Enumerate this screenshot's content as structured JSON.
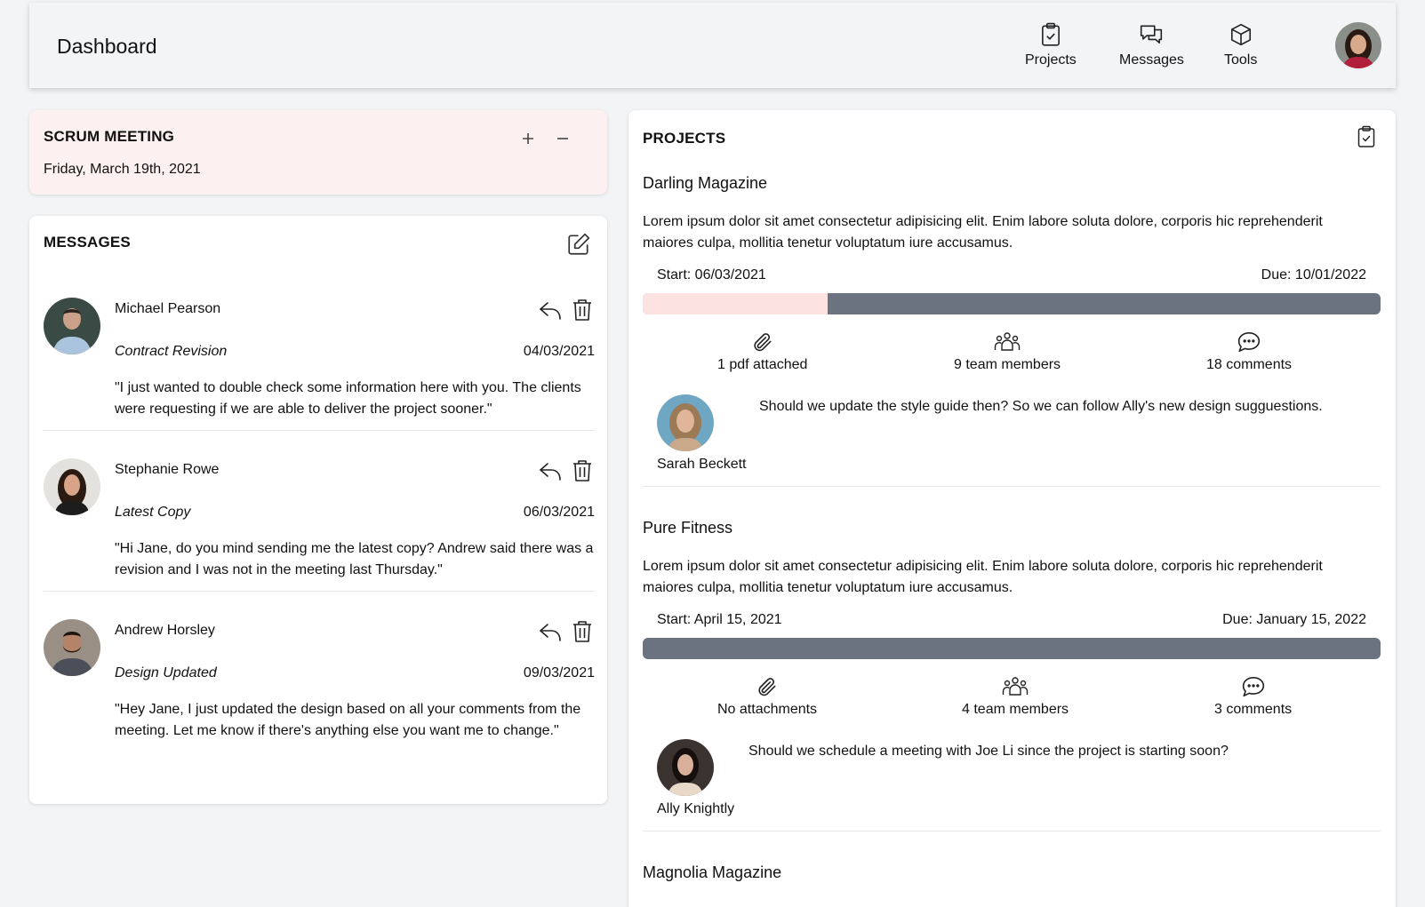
{
  "header": {
    "title": "Dashboard",
    "nav": [
      {
        "label": "Projects",
        "icon": "clipboard-check-icon"
      },
      {
        "label": "Messages",
        "icon": "chat-bubbles-icon"
      },
      {
        "label": "Tools",
        "icon": "cube-icon"
      }
    ]
  },
  "scrum": {
    "title": "SCRUM MEETING",
    "date": "Friday, March 19th, 2021",
    "accent": "#fdf0f0"
  },
  "messages": {
    "title": "MESSAGES",
    "items": [
      {
        "sender": "Michael Pearson",
        "subject": "Contract Revision",
        "date": "04/03/2021",
        "body": "\"I just wanted to double check some information here with you. The clients were requesting if we are able to deliver the project sooner.\""
      },
      {
        "sender": "Stephanie Rowe",
        "subject": "Latest Copy",
        "date": "06/03/2021",
        "body": "\"Hi Jane, do you mind sending me the latest copy? Andrew said there was a revision and I was not in the meeting last Thursday.\""
      },
      {
        "sender": "Andrew Horsley",
        "subject": "Design Updated",
        "date": "09/03/2021",
        "body": "\"Hey Jane, I just updated the design based on all your comments from the meeting. Let me know if there's anything else you want me to change.\""
      }
    ]
  },
  "projects": {
    "title": "PROJECTS",
    "items": [
      {
        "name": "Darling Magazine",
        "description": "Lorem ipsum dolor sit amet consectetur adipisicing elit. Enim labore soluta dolore, corporis hic reprehenderit maiores culpa, mollitia tenetur voluptatum iure accusamus.",
        "start": "Start: 06/03/2021",
        "due": "Due: 10/01/2022",
        "progress": 0.25,
        "attachments": "1 pdf attached",
        "team": "9 team members",
        "comments": "18 comments",
        "commenter": "Sarah Beckett",
        "comment": "Should we update the style guide then? So we can follow Ally's new design sugguestions."
      },
      {
        "name": "Pure Fitness",
        "description": "Lorem ipsum dolor sit amet consectetur adipisicing elit. Enim labore soluta dolore, corporis hic reprehenderit maiores culpa, mollitia tenetur voluptatum iure accusamus.",
        "start": "Start: April 15, 2021",
        "due": "Due: January 15, 2022",
        "progress": 0,
        "attachments": "No attachments",
        "team": "4 team members",
        "comments": "3 comments",
        "commenter": "Ally Knightly",
        "comment": "Should we schedule a meeting with Joe Li since the project is starting soon?"
      },
      {
        "name": "Magnolia Magazine"
      }
    ]
  },
  "colors": {
    "progress_fill": "#fde2e2",
    "progress_track": "#6b7280",
    "background": "#f3f4f6"
  }
}
